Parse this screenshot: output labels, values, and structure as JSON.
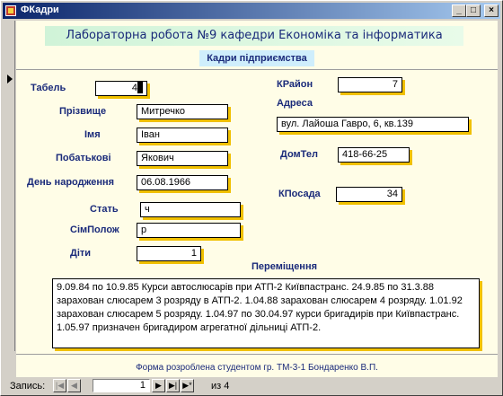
{
  "window": {
    "title": "ФКадри",
    "minimize": "_",
    "maximize": "□",
    "close": "×"
  },
  "header": {
    "title": "Лабораторна робота №9 кафедри Економіка та інформатика",
    "subtitle": "Кадри підприємства"
  },
  "fields": {
    "tabel": {
      "label": "Табель",
      "value": "4"
    },
    "prizvyshche": {
      "label": "Прізвище",
      "value": "Митречко"
    },
    "imia": {
      "label": "Імя",
      "value": "Іван"
    },
    "pobatkovi": {
      "label": "Побатькові",
      "value": "Якович"
    },
    "den_narodzhennia": {
      "label": "День народження",
      "value": "06.08.1966"
    },
    "stat": {
      "label": "Стать",
      "value": "ч"
    },
    "simpolozh": {
      "label": "СімПолож",
      "value": "р"
    },
    "dity": {
      "label": "Діти",
      "value": "1"
    },
    "krajon": {
      "label": "КРайон",
      "value": "7"
    },
    "adresa": {
      "label": "Адреса",
      "value": "вул. Лайоша Гавро, 6, кв.139"
    },
    "domtel": {
      "label": "ДомТел",
      "value": "418-66-25"
    },
    "kposada": {
      "label": "КПосада",
      "value": "34"
    }
  },
  "peremishchennia": {
    "label": "Переміщення",
    "value": "9.09.84 по 10.9.85 Курси автослюсарів при АТП-2 Київпастранс. 24.9.85 по 31.3.88 зарахован слюсарем 3 розряду в АТП-2.  1.04.88 зарахован слюсарем 4 розряду. 1.01.92 зарахован слюсарем 5 розряду. 1.04.97 по 30.04.97 курси бригадирів при Київпастранс. 1.05.97 призначен бригадиром агрегатної дільниці АТП-2."
  },
  "footer": {
    "credits": "Форма розроблена студентом гр. ТМ-3-1 Бондаренко В.П."
  },
  "navigation": {
    "label": "Запись:",
    "first": "|◀",
    "prev": "◀",
    "current": "1",
    "next": "▶",
    "last": "▶|",
    "new": "▶*",
    "of_text": "из 4"
  }
}
